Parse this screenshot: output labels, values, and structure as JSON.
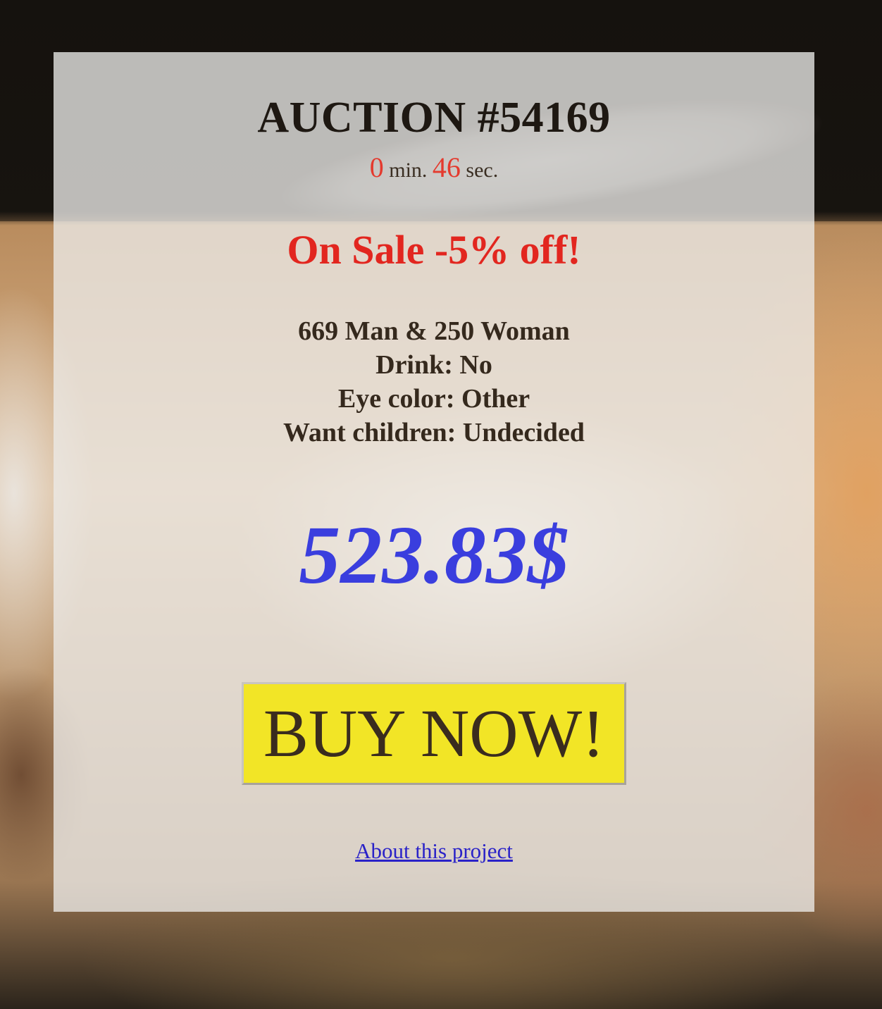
{
  "auction": {
    "title": "AUCTION #54169",
    "timer": {
      "minutes": "0",
      "min_label": "min.",
      "seconds": "46",
      "sec_label": "sec."
    },
    "sale_banner": "On Sale -5% off!",
    "details": [
      "669 Man & 250 Woman",
      "Drink: No",
      "Eye color: Other",
      "Want children: Undecided"
    ],
    "price": "523.83$",
    "buy_button_label": "BUY NOW!",
    "about_link": "About this project"
  },
  "colors": {
    "title": "#1e1812",
    "timer_numbers": "#e43a2e",
    "sale": "#e2261f",
    "price": "#3a3ede",
    "buy_button_bg": "#f2e526",
    "link": "#2a22c8"
  }
}
